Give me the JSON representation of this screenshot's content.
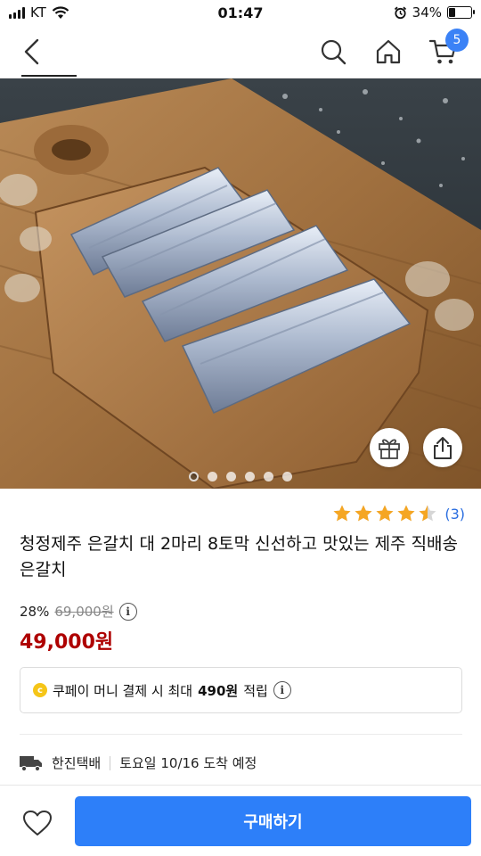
{
  "status_bar": {
    "carrier": "KT",
    "time": "01:47",
    "battery_percent": "34%",
    "battery_level": 0.34
  },
  "nav": {
    "cart_count": "5",
    "icons": [
      "back-icon",
      "search-icon",
      "home-icon",
      "cart-icon"
    ]
  },
  "gallery": {
    "image_count": 6,
    "active_index": 0,
    "icons": [
      "gift-icon",
      "share-icon"
    ]
  },
  "rating": {
    "stars": 4.5,
    "count": "(3)",
    "star_color": "#f5a623"
  },
  "product": {
    "title": "청정제주 은갈치 대 2마리 8토막 신선하고 맛있는 제주 직배송 은갈치",
    "discount": "28%",
    "original_price": "69,000원",
    "sale_price": "49,000원",
    "sale_price_color": "#ae0000"
  },
  "coupay": {
    "prefix": "쿠페이 머니 결제 시 최대",
    "amount": "490원",
    "suffix": "적립"
  },
  "delivery": {
    "carrier": "한진택배",
    "eta": "토요일 10/16 도착 예정"
  },
  "bottom": {
    "buy_label": "구매하기",
    "accent": "#2d7ff9"
  }
}
